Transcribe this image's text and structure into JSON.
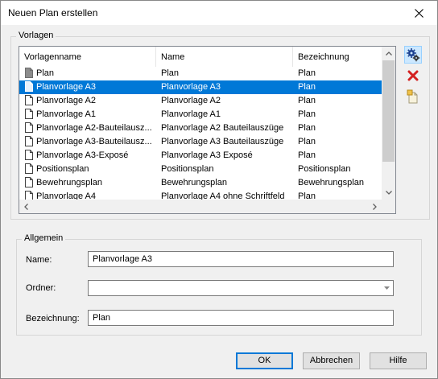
{
  "window": {
    "title": "Neuen Plan erstellen"
  },
  "templates": {
    "legend": "Vorlagen",
    "columns": [
      "Vorlagenname",
      "Name",
      "Bezeichnung"
    ],
    "rows": [
      {
        "template": "Plan",
        "name": "Plan",
        "designation": "Plan",
        "icon": "plan-icon",
        "selected": false
      },
      {
        "template": "Planvorlage A3",
        "name": "Planvorlage A3",
        "designation": "Plan",
        "icon": "document-icon",
        "selected": true
      },
      {
        "template": "Planvorlage A2",
        "name": "Planvorlage A2",
        "designation": "Plan",
        "icon": "document-icon",
        "selected": false
      },
      {
        "template": "Planvorlage A1",
        "name": "Planvorlage A1",
        "designation": "Plan",
        "icon": "document-icon",
        "selected": false
      },
      {
        "template": "Planvorlage A2-Bauteilausz...",
        "name": "Planvorlage A2 Bauteilauszüge",
        "designation": "Plan",
        "icon": "document-icon",
        "selected": false
      },
      {
        "template": "Planvorlage A3-Bauteilausz...",
        "name": "Planvorlage A3 Bauteilauszüge",
        "designation": "Plan",
        "icon": "document-icon",
        "selected": false
      },
      {
        "template": "Planvorlage A3-Exposé",
        "name": "Planvorlage A3 Exposé",
        "designation": "Plan",
        "icon": "document-icon",
        "selected": false
      },
      {
        "template": "Positionsplan",
        "name": "Positionsplan",
        "designation": "Positionsplan",
        "icon": "document-icon",
        "selected": false
      },
      {
        "template": "Bewehrungsplan",
        "name": "Bewehrungsplan",
        "designation": "Bewehrungsplan",
        "icon": "document-icon",
        "selected": false
      },
      {
        "template": "Planvorlage A4",
        "name": "Planvorlage A4 ohne Schriftfeld",
        "designation": "Plan",
        "icon": "document-icon",
        "selected": false
      }
    ]
  },
  "toolbar": {
    "icons": [
      "settings-gears-icon",
      "delete-icon",
      "new-template-icon"
    ]
  },
  "general": {
    "legend": "Allgemein",
    "name_label": "Name:",
    "name_value": "Planvorlage A3",
    "folder_label": "Ordner:",
    "folder_value": "",
    "designation_label": "Bezeichnung:",
    "designation_value": "Plan"
  },
  "buttons": {
    "ok": "OK",
    "cancel": "Abbrechen",
    "help": "Hilfe"
  },
  "colors": {
    "selection": "#0078d7",
    "delete": "#d42020"
  }
}
